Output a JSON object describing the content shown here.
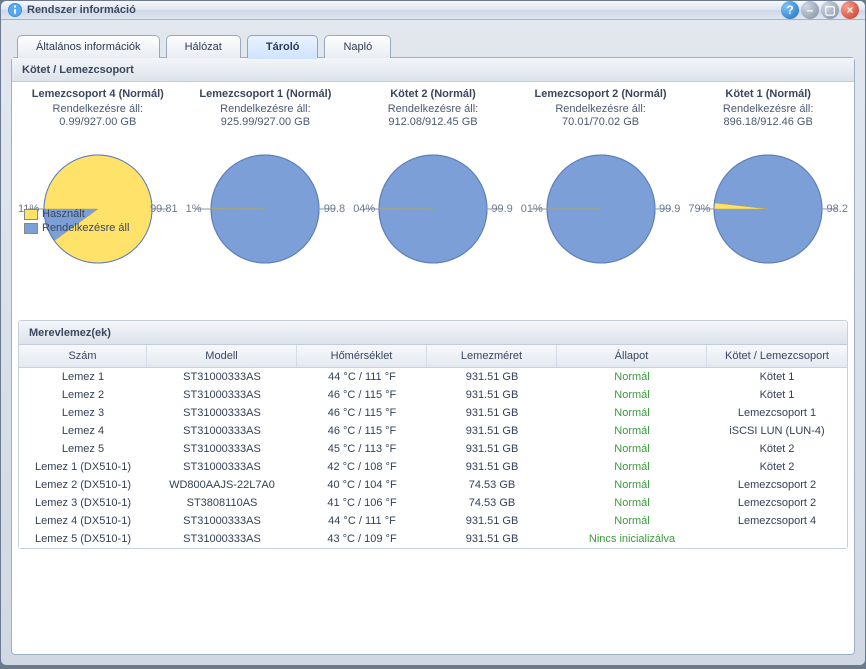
{
  "window": {
    "title": "Rendszer információ"
  },
  "tabs": [
    {
      "label": "Általános információk",
      "active": false
    },
    {
      "label": "Hálózat",
      "active": false
    },
    {
      "label": "Tároló",
      "active": true
    },
    {
      "label": "Napló",
      "active": false
    }
  ],
  "volumes_section_title": "Kötet / Lemezcsoport",
  "legend": {
    "used": "Használt",
    "available": "Rendelkezésre áll"
  },
  "colors": {
    "used": "#ffe26a",
    "available": "#7c9fd8",
    "status_normal": "#3a9c3a"
  },
  "volumes": [
    {
      "name": "Lemezcsoport 4",
      "status": "Normál",
      "avail_label": "Rendelkezésre áll:",
      "avail_value": "0.99/927.00 GB",
      "used_pct_label": "11%",
      "avail_pct_label": "99.81",
      "used_pct": 0.11,
      "avail_pct": 99.81
    },
    {
      "name": "Lemezcsoport 1",
      "status": "Normál",
      "avail_label": "Rendelkezésre áll:",
      "avail_value": "925.99/927.00 GB",
      "used_pct_label": "1%",
      "avail_pct_label": "99.8",
      "used_pct": 0.11,
      "avail_pct": 99.8
    },
    {
      "name": "Kötet 2",
      "status": "Normál",
      "avail_label": "Rendelkezésre áll:",
      "avail_value": "912.08/912.45 GB",
      "used_pct_label": "04%",
      "avail_pct_label": "99.9",
      "used_pct": 0.04,
      "avail_pct": 99.9
    },
    {
      "name": "Lemezcsoport 2",
      "status": "Normál",
      "avail_label": "Rendelkezésre áll:",
      "avail_value": "70.01/70.02 GB",
      "used_pct_label": "01%",
      "avail_pct_label": "99.9",
      "used_pct": 0.01,
      "avail_pct": 99.9
    },
    {
      "name": "Kötet 1",
      "status": "Normál",
      "avail_label": "Rendelkezésre áll:",
      "avail_value": "896.18/912.46 GB",
      "used_pct_label": "79%",
      "avail_pct_label": "98.2",
      "used_pct": 1.79,
      "avail_pct": 98.2
    }
  ],
  "chart_data": [
    {
      "type": "pie",
      "title": "Lemezcsoport 4 (Normál)",
      "series": [
        {
          "name": "Használt",
          "value": 0.11
        },
        {
          "name": "Rendelkezésre áll",
          "value": 99.81
        }
      ],
      "note": "Chart label reads 11% for used; yellow slice drawn disproportionately large in screenshot"
    },
    {
      "type": "pie",
      "title": "Lemezcsoport 1 (Normál)",
      "series": [
        {
          "name": "Használt",
          "value": 0.11
        },
        {
          "name": "Rendelkezésre áll",
          "value": 99.8
        }
      ]
    },
    {
      "type": "pie",
      "title": "Kötet 2 (Normál)",
      "series": [
        {
          "name": "Használt",
          "value": 0.04
        },
        {
          "name": "Rendelkezésre áll",
          "value": 99.9
        }
      ]
    },
    {
      "type": "pie",
      "title": "Lemezcsoport 2 (Normál)",
      "series": [
        {
          "name": "Használt",
          "value": 0.01
        },
        {
          "name": "Rendelkezésre áll",
          "value": 99.9
        }
      ]
    },
    {
      "type": "pie",
      "title": "Kötet 1 (Normál)",
      "series": [
        {
          "name": "Használt",
          "value": 1.79
        },
        {
          "name": "Rendelkezésre áll",
          "value": 98.2
        }
      ]
    }
  ],
  "hdd_section_title": "Merevlemez(ek)",
  "hdd_columns": [
    "Szám",
    "Modell",
    "Hőmérséklet",
    "Lemezméret",
    "Állapot",
    "Kötet / Lemezcsoport"
  ],
  "hdd_rows": [
    {
      "num": "Lemez 1",
      "model": "ST31000333AS",
      "temp": "44 °C / 111 °F",
      "size": "931.51 GB",
      "status": "Normál",
      "vol": "Kötet 1"
    },
    {
      "num": "Lemez 2",
      "model": "ST31000333AS",
      "temp": "46 °C / 115 °F",
      "size": "931.51 GB",
      "status": "Normál",
      "vol": "Kötet 1"
    },
    {
      "num": "Lemez 3",
      "model": "ST31000333AS",
      "temp": "46 °C / 115 °F",
      "size": "931.51 GB",
      "status": "Normál",
      "vol": "Lemezcsoport 1"
    },
    {
      "num": "Lemez 4",
      "model": "ST31000333AS",
      "temp": "46 °C / 115 °F",
      "size": "931.51 GB",
      "status": "Normál",
      "vol": "iSCSI LUN (LUN-4)"
    },
    {
      "num": "Lemez 5",
      "model": "ST31000333AS",
      "temp": "45 °C / 113 °F",
      "size": "931.51 GB",
      "status": "Normál",
      "vol": "Kötet 2"
    },
    {
      "num": "Lemez 1 (DX510-1)",
      "model": "ST31000333AS",
      "temp": "42 °C / 108 °F",
      "size": "931.51 GB",
      "status": "Normál",
      "vol": "Kötet 2"
    },
    {
      "num": "Lemez 2 (DX510-1)",
      "model": "WD800AAJS-22L7A0",
      "temp": "40 °C / 104 °F",
      "size": "74.53 GB",
      "status": "Normál",
      "vol": "Lemezcsoport 2"
    },
    {
      "num": "Lemez 3 (DX510-1)",
      "model": "ST3808110AS",
      "temp": "41 °C / 106 °F",
      "size": "74.53 GB",
      "status": "Normál",
      "vol": "Lemezcsoport 2"
    },
    {
      "num": "Lemez 4 (DX510-1)",
      "model": "ST31000333AS",
      "temp": "44 °C / 111 °F",
      "size": "931.51 GB",
      "status": "Normál",
      "vol": "Lemezcsoport 4"
    },
    {
      "num": "Lemez 5 (DX510-1)",
      "model": "ST31000333AS",
      "temp": "43 °C / 109 °F",
      "size": "931.51 GB",
      "status": "Nincs inicializálva",
      "vol": ""
    }
  ]
}
